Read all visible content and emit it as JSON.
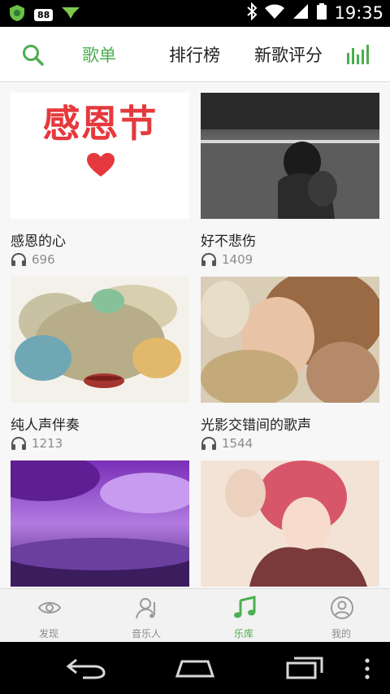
{
  "status_bar": {
    "time": "19:35",
    "notification_badge": "88"
  },
  "header": {
    "tabs": [
      {
        "label": "歌单",
        "active": true
      },
      {
        "label": "排行榜",
        "active": false
      },
      {
        "label": "新歌评分",
        "active": false
      }
    ]
  },
  "playlists": [
    {
      "title": "感恩的心",
      "plays": "696",
      "cover_text": "感恩节"
    },
    {
      "title": "好不悲伤",
      "plays": "1409"
    },
    {
      "title": "纯人声伴奏",
      "plays": "1213"
    },
    {
      "title": "光影交错间的歌声",
      "plays": "1544"
    },
    {
      "title": "",
      "plays": ""
    },
    {
      "title": "",
      "plays": ""
    }
  ],
  "bottom_nav": [
    {
      "label": "发现",
      "icon": "eye-icon",
      "active": false
    },
    {
      "label": "音乐人",
      "icon": "musician-icon",
      "active": false
    },
    {
      "label": "乐库",
      "icon": "music-note-icon",
      "active": true
    },
    {
      "label": "我的",
      "icon": "profile-icon",
      "active": false
    }
  ],
  "colors": {
    "accent": "#4caf50",
    "text": "#222222",
    "muted": "#8c8c8c"
  }
}
